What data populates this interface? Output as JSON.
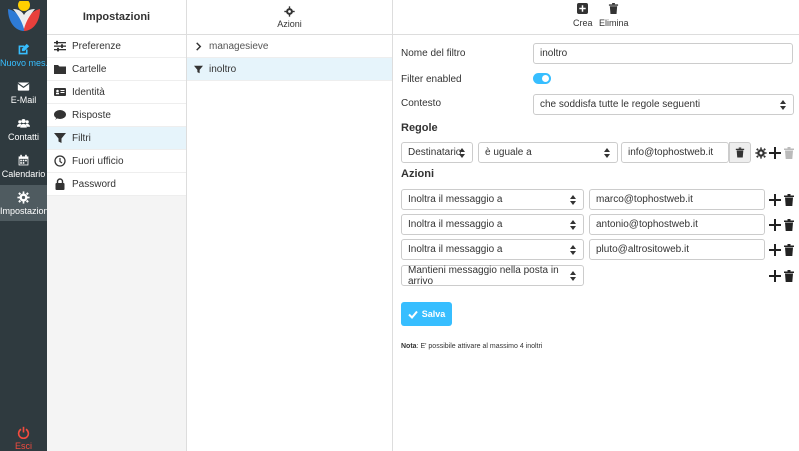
{
  "nav": {
    "compose": "Nuovo mes...",
    "mail": "E-Mail",
    "contacts": "Contatti",
    "calendar": "Calendario",
    "settings": "Impostazioni",
    "logout": "Esci"
  },
  "settings": {
    "title": "Impostazioni",
    "items": [
      "Preferenze",
      "Cartelle",
      "Identità",
      "Risposte",
      "Filtri",
      "Fuori ufficio",
      "Password"
    ],
    "active": "Filtri"
  },
  "filtersets": {
    "actions_label": "Azioni",
    "set_name": "managesieve",
    "filter_name": "inoltro"
  },
  "toolbar": {
    "create": "Crea",
    "delete": "Elimina"
  },
  "form": {
    "name_label": "Nome del filtro",
    "name_value": "inoltro",
    "enabled_label": "Filter enabled",
    "context_label": "Contesto",
    "context_value": "che soddisfa tutte le regole seguenti",
    "rules_title": "Regole",
    "rule": {
      "header": "Destinatario",
      "op": "è uguale a",
      "value": "info@tophostweb.it"
    },
    "actions_title": "Azioni",
    "actions": [
      {
        "type": "Inoltra il messaggio a",
        "value": "marco@tophostweb.it"
      },
      {
        "type": "Inoltra il messaggio a",
        "value": "antonio@tophostweb.it"
      },
      {
        "type": "Inoltra il messaggio a",
        "value": "pluto@altrositoweb.it"
      },
      {
        "type": "Mantieni messaggio nella posta in arrivo",
        "value": ""
      }
    ],
    "save": "Salva",
    "note_label": "Nota",
    "note_text": ": E' possibile attivare al massimo 4 inoltri"
  }
}
